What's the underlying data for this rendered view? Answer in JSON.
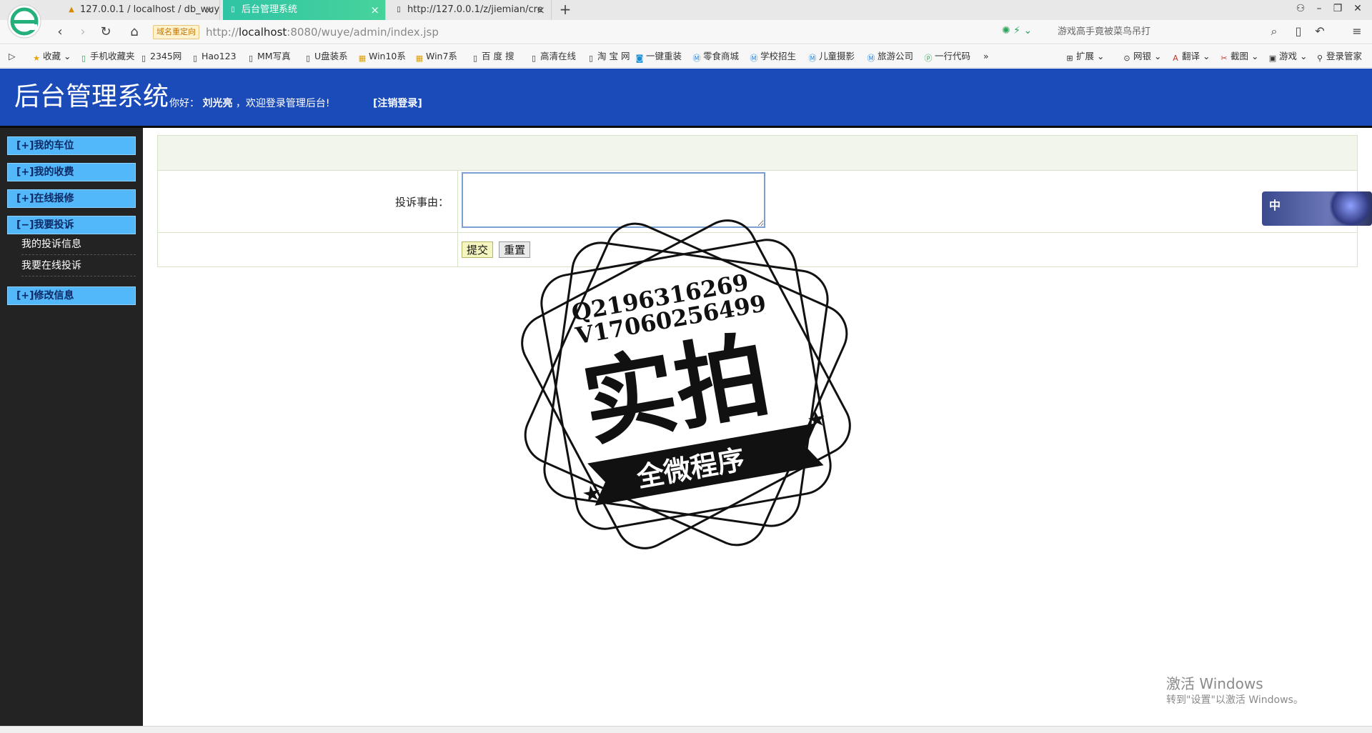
{
  "browser": {
    "tabs": [
      {
        "icon": "PMA",
        "title": "127.0.0.1 / localhost / db_wuy",
        "active": false
      },
      {
        "icon": "doc",
        "title": "后台管理系统",
        "active": true
      },
      {
        "icon": "doc",
        "title": "http://127.0.0.1/z/jiemian/cre",
        "active": false
      }
    ],
    "new_tab": "+",
    "redirect_badge": "域名重定向",
    "url_prefix": "http://",
    "url_host": "localhost",
    "url_rest": ":8080/wuye/admin/index.jsp",
    "search_placeholder": "游戏高手竟被菜鸟吊打",
    "bookmarks": [
      "收藏",
      "手机收藏夹",
      "2345网",
      "Hao123",
      "MM写真",
      "U盘装系",
      "Win10系",
      "Win7系",
      "百 度 搜",
      "高清在线",
      "淘 宝 网",
      "一键重装",
      "零食商城",
      "学校招生",
      "儿童摄影",
      "旅游公司",
      "一行代码",
      "»"
    ],
    "bookmark_tools": [
      "扩展",
      "网银",
      "翻译",
      "截图",
      "游戏",
      "登录管家"
    ]
  },
  "header": {
    "title": "后台管理系统",
    "greeting_prefix": "你好：",
    "user_name": "刘光亮",
    "greeting_suffix": "，欢迎登录管理后台!",
    "logout": "[注销登录]"
  },
  "sidebar": {
    "menu": [
      {
        "label": "[+]我的车位"
      },
      {
        "label": "[+]我的收费"
      },
      {
        "label": "[+]在线报修"
      },
      {
        "label": "[−]我要投诉",
        "children": [
          "我的投诉信息",
          "我要在线投诉"
        ]
      },
      {
        "label": "[+]修改信息"
      }
    ]
  },
  "form": {
    "reason_label": "投诉事由：",
    "reason_value": "",
    "submit_label": "提交",
    "reset_label": "重置"
  },
  "watermark": {
    "line1": "Q2196316269",
    "line2": "V17060256499",
    "main": "实拍",
    "banner": "全微程序"
  },
  "ime_widget": {
    "label": "中"
  },
  "os_notice": {
    "title": "激活 Windows",
    "subtitle": "转到\"设置\"以激活 Windows。"
  }
}
